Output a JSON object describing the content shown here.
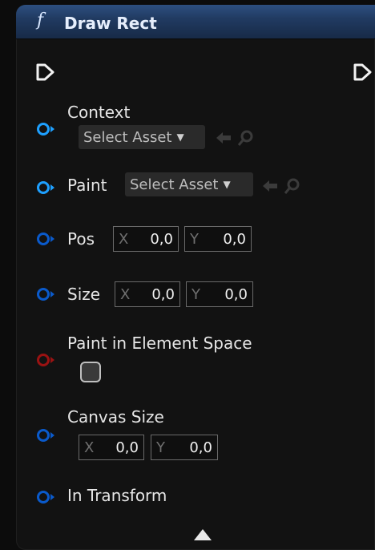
{
  "node": {
    "function_glyph": "f",
    "title": "Draw Rect",
    "colors": {
      "header_top": "#2d4f80",
      "object_pin": "#1ea0ff",
      "struct_pin": "#0a5acb",
      "bool_pin": "#9a1212"
    }
  },
  "pins": {
    "context": {
      "label": "Context",
      "asset_label": "Select Asset",
      "icon": "object-pin-icon"
    },
    "paint": {
      "label": "Paint",
      "asset_label": "Select Asset",
      "icon": "object-pin-icon"
    },
    "pos": {
      "label": "Pos",
      "x_axis": "X",
      "x_value": "0,0",
      "y_axis": "Y",
      "y_value": "0,0"
    },
    "size": {
      "label": "Size",
      "x_axis": "X",
      "x_value": "0,0",
      "y_axis": "Y",
      "y_value": "0,0"
    },
    "paint_in_element_space": {
      "label": "Paint in Element Space",
      "checked": false
    },
    "canvas_size": {
      "label": "Canvas Size",
      "x_axis": "X",
      "x_value": "0,0",
      "y_axis": "Y",
      "y_value": "0,0"
    },
    "in_transform": {
      "label": "In Transform"
    }
  }
}
